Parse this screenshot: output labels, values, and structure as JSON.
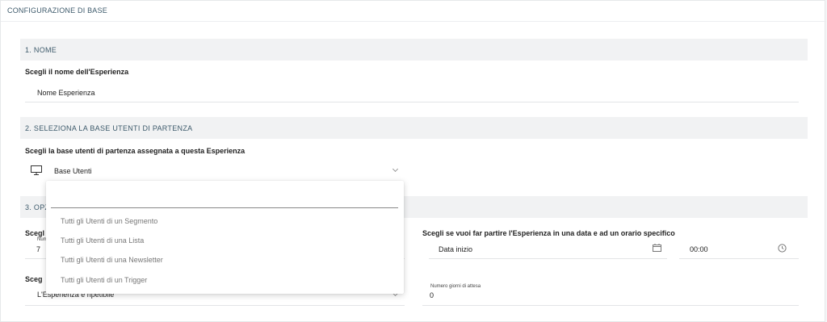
{
  "panel": {
    "title": "CONFIGURAZIONE DI BASE"
  },
  "section1": {
    "title": "1. NOME",
    "label": "Scegli il nome dell'Esperienza",
    "value": "Nome Esperienza"
  },
  "section2": {
    "title": "2. SELEZIONA LA BASE UTENTI DI PARTENZA",
    "label": "Scegli la base utenti di partenza assegnata a questa Esperienza",
    "select_value": "Base Utenti",
    "icon": "monitor-icon"
  },
  "section3": {
    "title_partial": "3. OPZ",
    "left_label_partial": "Scegl",
    "mini_label_partial": "Num",
    "number_value": "7",
    "left_label2_partial": "Sceg",
    "repeat_value": "L'Esperienza è ripetibile",
    "right_label": "Scegli se vuoi far partire l'Esperienza in una data e ad un orario specifico",
    "date_placeholder": "Data inizio",
    "time_value": "00:00",
    "wait_days_label": "Numero giorni di attesa",
    "wait_days_value": "0"
  },
  "dropdown": {
    "options": [
      "Tutti gli Utenti di un Segmento",
      "Tutti gli Utenti di una Lista",
      "Tutti gli Utenti di una Newsletter",
      "Tutti gli Utenti di un Trigger"
    ]
  }
}
